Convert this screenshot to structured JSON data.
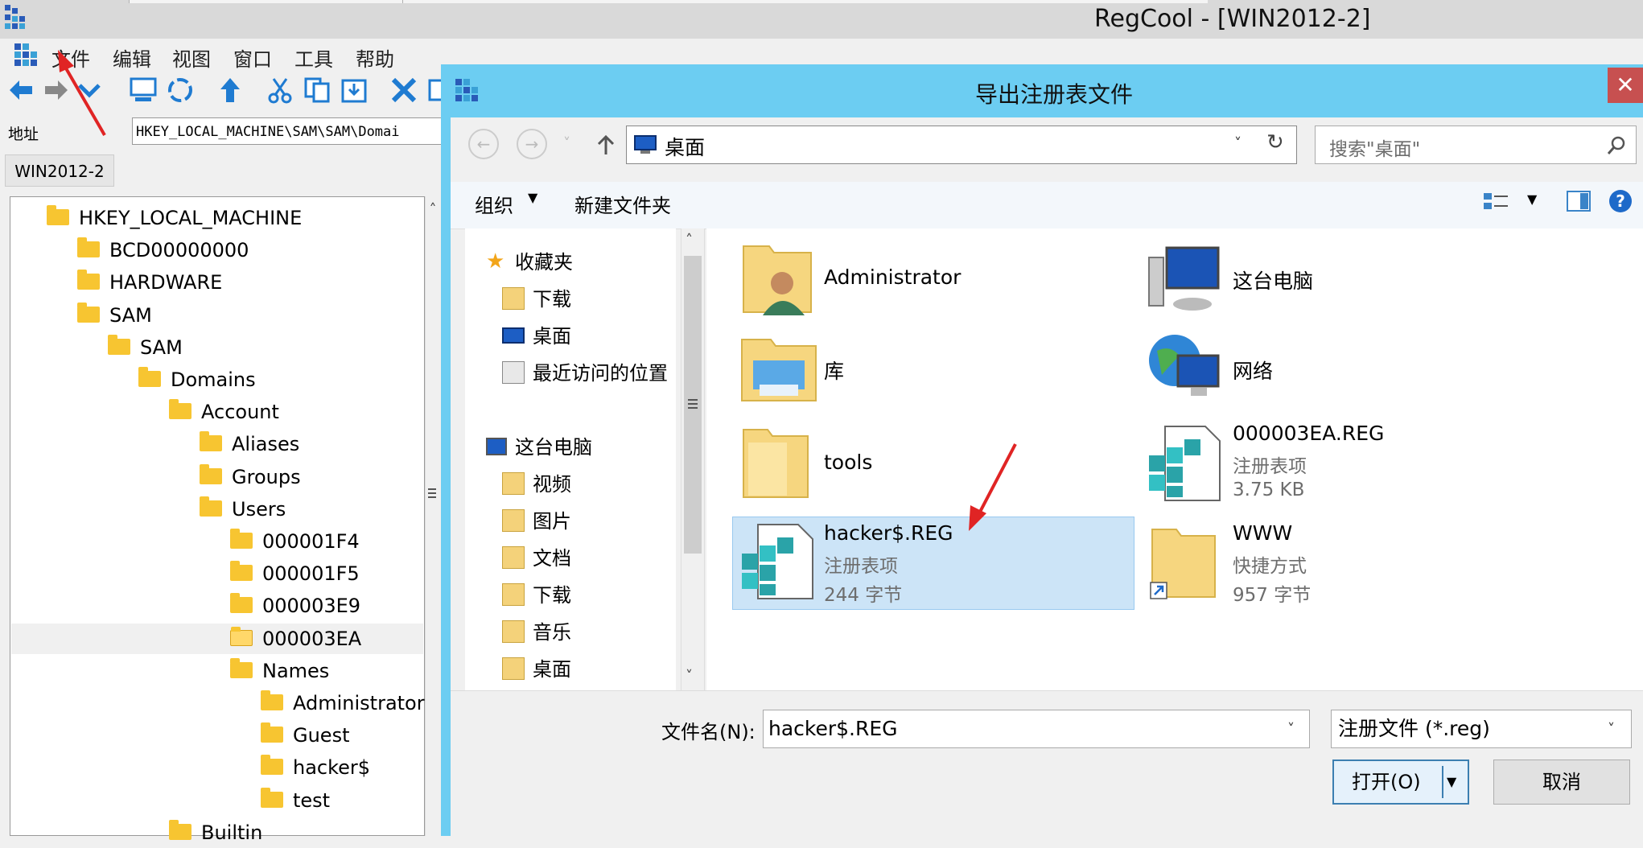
{
  "app": {
    "title": "RegCool - [WIN2012-2]",
    "menu": [
      "文件",
      "编辑",
      "视图",
      "窗口",
      "工具",
      "帮助"
    ],
    "address_label": "地址",
    "address_value": "HKEY_LOCAL_MACHINE\\SAM\\SAM\\Domai",
    "host_tab": "WIN2012-2",
    "tree": [
      {
        "label": "HKEY_LOCAL_MACHINE",
        "depth": 0
      },
      {
        "label": "BCD00000000",
        "depth": 1
      },
      {
        "label": "HARDWARE",
        "depth": 1
      },
      {
        "label": "SAM",
        "depth": 1
      },
      {
        "label": "SAM",
        "depth": 2
      },
      {
        "label": "Domains",
        "depth": 3
      },
      {
        "label": "Account",
        "depth": 4
      },
      {
        "label": "Aliases",
        "depth": 5
      },
      {
        "label": "Groups",
        "depth": 5
      },
      {
        "label": "Users",
        "depth": 5
      },
      {
        "label": "000001F4",
        "depth": 6
      },
      {
        "label": "000001F5",
        "depth": 6
      },
      {
        "label": "000003E9",
        "depth": 6
      },
      {
        "label": "000003EA",
        "depth": 6,
        "selected": true
      },
      {
        "label": "Names",
        "depth": 6
      },
      {
        "label": "Administrator",
        "depth": 7
      },
      {
        "label": "Guest",
        "depth": 7
      },
      {
        "label": "hacker$",
        "depth": 7
      },
      {
        "label": "test",
        "depth": 7
      },
      {
        "label": "Builtin",
        "depth": 4
      }
    ]
  },
  "dialog": {
    "title": "导出注册表文件",
    "close": "✕",
    "address": "桌面",
    "search_placeholder": "搜索\"桌面\"",
    "organize": "组织",
    "new_folder": "新建文件夹",
    "nav": {
      "favorites": "收藏夹",
      "fav_items": [
        "下载",
        "桌面",
        "最近访问的位置"
      ],
      "this_pc": "这台电脑",
      "pc_items": [
        "视频",
        "图片",
        "文档",
        "下载",
        "音乐",
        "桌面"
      ]
    },
    "files": [
      {
        "name": "Administrator",
        "icon": "user-folder-icon"
      },
      {
        "name": "这台电脑",
        "icon": "computer-icon"
      },
      {
        "name": "库",
        "icon": "library-icon"
      },
      {
        "name": "网络",
        "icon": "network-icon"
      },
      {
        "name": "tools",
        "icon": "folder-icon"
      },
      {
        "name": "000003EA.REG",
        "type": "注册表项",
        "size": "3.75 KB",
        "icon": "reg-file-icon"
      },
      {
        "name": "hacker$.REG",
        "type": "注册表项",
        "size": "244 字节",
        "icon": "reg-file-icon",
        "selected": true
      },
      {
        "name": "WWW",
        "type": "快捷方式",
        "size": "957 字节",
        "icon": "shortcut-folder-icon"
      }
    ],
    "filename_label": "文件名(N):",
    "filename_value": "hacker$.REG",
    "filetype": "注册文件 (*.reg)",
    "open_button": "打开(O)",
    "cancel_button": "取消"
  },
  "colors": {
    "dialog_frame": "#6ccdf2",
    "selection": "#cce4f7",
    "folder": "#f7c531",
    "annotation_arrow": "#e02424"
  }
}
